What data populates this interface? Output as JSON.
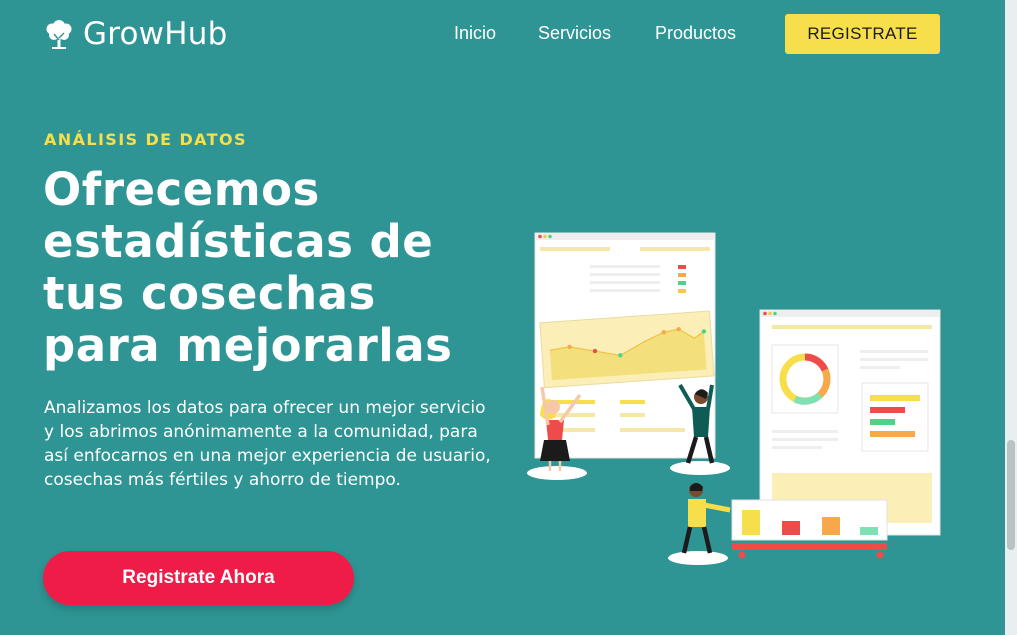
{
  "brand": {
    "name": "GrowHub",
    "logo_icon": "tree-icon"
  },
  "nav": {
    "links": [
      "Inicio",
      "Servicios",
      "Productos"
    ],
    "cta": "REGISTRATE"
  },
  "hero": {
    "eyebrow": "ANÁLISIS DE DATOS",
    "headline": [
      "Ofrecemos",
      "estadísticas de",
      "tus cosechas",
      "para mejorarlas"
    ],
    "body": "Analizamos los datos para ofrecer un mejor servicio y los abrimos anónimamente a la comunidad, para así enfocarnos en una mejor experiencia de usuario, cosechas más fértiles y ahorro de tiempo.",
    "cta": "Registrate Ahora"
  },
  "colors": {
    "background": "#2e9594",
    "accent_yellow": "#f7df4b",
    "cta_red": "#ee1c47",
    "text": "#ffffff"
  }
}
